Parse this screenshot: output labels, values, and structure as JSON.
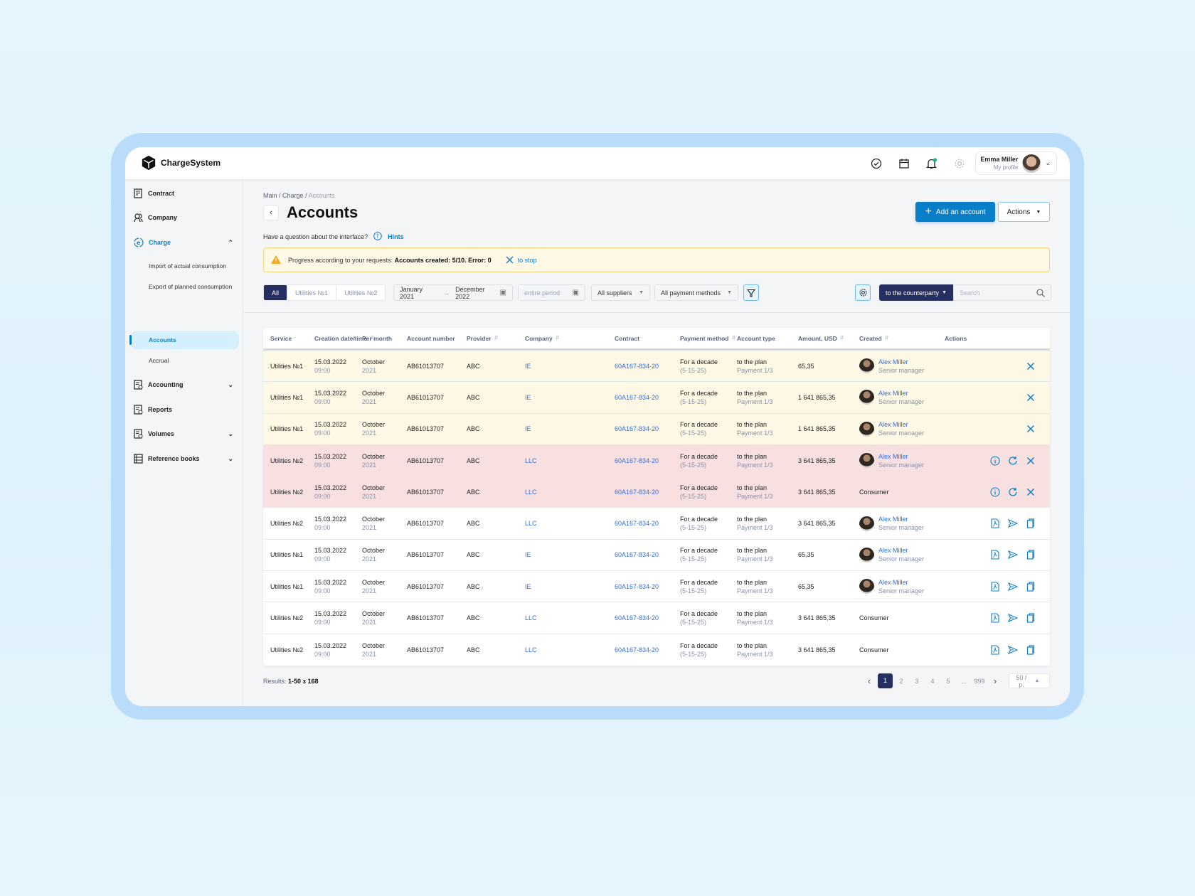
{
  "app": {
    "name": "ChargeSystem"
  },
  "header": {
    "user_name": "Emma Miller",
    "user_sub": "My profile",
    "icons": [
      "check-circle-icon",
      "calendar-icon",
      "bell-icon",
      "gear-icon"
    ],
    "notification_dot_color": "#1db38b"
  },
  "sidebar": {
    "items": [
      {
        "label": "Contract",
        "icon": "contract-icon"
      },
      {
        "label": "Company",
        "icon": "company-icon"
      },
      {
        "label": "Charge",
        "icon": "charge-icon",
        "expanded": true
      },
      {
        "label": "Accounting",
        "icon": "accounting-icon"
      },
      {
        "label": "Reports",
        "icon": "reports-icon"
      },
      {
        "label": "Volumes",
        "icon": "volumes-icon"
      },
      {
        "label": "Reference books",
        "icon": "reference-books-icon"
      }
    ],
    "sub_items": [
      "Import of actual consumption",
      "Export of planned consumption",
      "Accounts",
      "Accrual"
    ],
    "active": "Accounts"
  },
  "breadcrumb": [
    "Main",
    "Charge",
    "Accounts"
  ],
  "page": {
    "title": "Accounts",
    "add_button": "Add an account",
    "actions_button": "Actions",
    "hint_question": "Have a question about the interface?",
    "hint_link": "Hints"
  },
  "alert": {
    "text": "Progress according to your requests:",
    "bold": "Accounts created: 5/10. Error: 0",
    "stop": "to stop"
  },
  "filters": {
    "tabs": [
      "All",
      "Utilities №1",
      "Utilities №2"
    ],
    "active_tab": "All",
    "date_from": "January 2021",
    "date_to": "December 2022",
    "period_placeholder": "entire period",
    "suppliers": "All suppliers",
    "payment_methods": "All payment methods",
    "counterparty": "to the counterparty",
    "search_placeholder": "Search"
  },
  "table": {
    "columns": [
      "Service",
      "Creation date/time",
      "Per month",
      "Account number",
      "Provider",
      "Company",
      "Contract",
      "Payment method",
      "Account type",
      "Amount, USD",
      "Created",
      "Actions"
    ],
    "rows": [
      {
        "status": "warning",
        "service": "Utilities №1",
        "date": "15.03.2022",
        "time": "09:00",
        "month": "October",
        "year": "2021",
        "account": "AB61013707",
        "provider": "ABC",
        "company": "IE",
        "contract": "60A167-834-20",
        "pay": "For a decade",
        "pay_sub": "(5-15-25)",
        "type": "to the plan",
        "type_sub": "Payment 1/3",
        "amount": "65,35",
        "creator": "Alex Miller",
        "creator_role": "Senior manager",
        "actions": [
          "close"
        ]
      },
      {
        "status": "warning",
        "service": "Utilities №1",
        "date": "15.03.2022",
        "time": "09:00",
        "month": "October",
        "year": "2021",
        "account": "AB61013707",
        "provider": "ABC",
        "company": "IE",
        "contract": "60A167-834-20",
        "pay": "For a decade",
        "pay_sub": "(5-15-25)",
        "type": "to the plan",
        "type_sub": "Payment 1/3",
        "amount": "1 641 865,35",
        "creator": "Alex Miller",
        "creator_role": "Senior manager",
        "actions": [
          "close"
        ]
      },
      {
        "status": "warning",
        "service": "Utilities №1",
        "date": "15.03.2022",
        "time": "09:00",
        "month": "October",
        "year": "2021",
        "account": "AB61013707",
        "provider": "ABC",
        "company": "IE",
        "contract": "60A167-834-20",
        "pay": "For a decade",
        "pay_sub": "(5-15-25)",
        "type": "to the plan",
        "type_sub": "Payment 1/3",
        "amount": "1 641 865,35",
        "creator": "Alex Miller",
        "creator_role": "Senior manager",
        "actions": [
          "close"
        ]
      },
      {
        "status": "error",
        "service": "Utilities №2",
        "date": "15.03.2022",
        "time": "09:00",
        "month": "October",
        "year": "2021",
        "account": "AB61013707",
        "provider": "ABC",
        "company": "LLC",
        "contract": "60A167-834-20",
        "pay": "For a decade",
        "pay_sub": "(5-15-25)",
        "type": "to the plan",
        "type_sub": "Payment 1/3",
        "amount": "3 641 865,35",
        "creator": "Alex Miller",
        "creator_role": "Senior manager",
        "actions": [
          "info",
          "retry",
          "close"
        ]
      },
      {
        "status": "error",
        "service": "Utilities №2",
        "date": "15.03.2022",
        "time": "09:00",
        "month": "October",
        "year": "2021",
        "account": "AB61013707",
        "provider": "ABC",
        "company": "LLC",
        "contract": "60A167-834-20",
        "pay": "For a decade",
        "pay_sub": "(5-15-25)",
        "type": "to the plan",
        "type_sub": "Payment 1/3",
        "amount": "3 641 865,35",
        "creator": "Consumer",
        "creator_role": "",
        "actions": [
          "info",
          "retry",
          "close"
        ]
      },
      {
        "status": "normal",
        "service": "Utilities №2",
        "date": "15.03.2022",
        "time": "09:00",
        "month": "October",
        "year": "2021",
        "account": "AB61013707",
        "provider": "ABC",
        "company": "LLC",
        "contract": "60A167-834-20",
        "pay": "For a decade",
        "pay_sub": "(5-15-25)",
        "type": "to the plan",
        "type_sub": "Payment 1/3",
        "amount": "3 641 865,35",
        "creator": "Alex Miller",
        "creator_role": "Senior manager",
        "actions": [
          "pdf",
          "send",
          "copy"
        ]
      },
      {
        "status": "normal",
        "service": "Utilities №1",
        "date": "15.03.2022",
        "time": "09:00",
        "month": "October",
        "year": "2021",
        "account": "AB61013707",
        "provider": "ABC",
        "company": "IE",
        "contract": "60A167-834-20",
        "pay": "For a decade",
        "pay_sub": "(5-15-25)",
        "type": "to the plan",
        "type_sub": "Payment 1/3",
        "amount": "65,35",
        "creator": "Alex Miller",
        "creator_role": "Senior manager",
        "actions": [
          "pdf",
          "send",
          "copy"
        ]
      },
      {
        "status": "normal",
        "service": "Utilities №1",
        "date": "15.03.2022",
        "time": "09:00",
        "month": "October",
        "year": "2021",
        "account": "AB61013707",
        "provider": "ABC",
        "company": "IE",
        "contract": "60A167-834-20",
        "pay": "For a decade",
        "pay_sub": "(5-15-25)",
        "type": "to the plan",
        "type_sub": "Payment 1/3",
        "amount": "65,35",
        "creator": "Alex Miller",
        "creator_role": "Senior manager",
        "actions": [
          "pdf",
          "send",
          "copy"
        ]
      },
      {
        "status": "normal",
        "service": "Utilities №2",
        "date": "15.03.2022",
        "time": "09:00",
        "month": "October",
        "year": "2021",
        "account": "AB61013707",
        "provider": "ABC",
        "company": "LLC",
        "contract": "60A167-834-20",
        "pay": "For a decade",
        "pay_sub": "(5-15-25)",
        "type": "to the plan",
        "type_sub": "Payment 1/3",
        "amount": "3 641 865,35",
        "creator": "Consumer",
        "creator_role": "",
        "actions": [
          "pdf",
          "send",
          "copy"
        ]
      },
      {
        "status": "normal",
        "service": "Utilities №2",
        "date": "15.03.2022",
        "time": "09:00",
        "month": "October",
        "year": "2021",
        "account": "AB61013707",
        "provider": "ABC",
        "company": "LLC",
        "contract": "60A167-834-20",
        "pay": "For a decade",
        "pay_sub": "(5-15-25)",
        "type": "to the plan",
        "type_sub": "Payment 1/3",
        "amount": "3 641 865,35",
        "creator": "Consumer",
        "creator_role": "",
        "actions": [
          "pdf",
          "send",
          "copy"
        ]
      }
    ]
  },
  "footer": {
    "results_label": "Results:",
    "results_value": "1-50 з 168",
    "pages": [
      "1",
      "2",
      "3",
      "4",
      "5",
      "...",
      "999"
    ],
    "current_page": "1",
    "per_page": "50 / p."
  },
  "colors": {
    "primary": "#0a7fc9",
    "navy": "#262f62",
    "warning_row": "#fdf8e6",
    "error_row": "#f8e0e1",
    "link": "#2f6fdc"
  }
}
